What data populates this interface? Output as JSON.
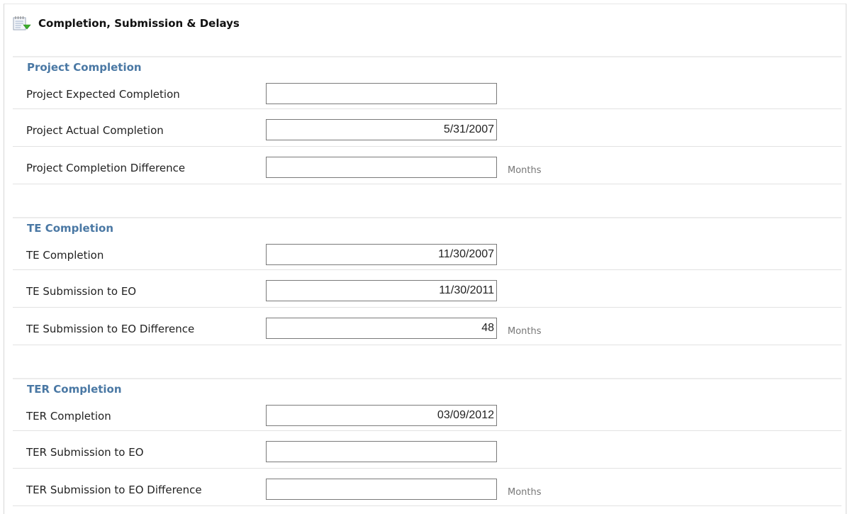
{
  "panel": {
    "title": "Completion, Submission & Delays",
    "icon": "notepad-checkmark-icon"
  },
  "colors": {
    "section_title": "#4a78a4",
    "row_divider": "#e2e2e2",
    "icon_accent": "#3cae2c"
  },
  "sections": [
    {
      "title": "Project Completion",
      "rows": [
        {
          "label": "Project Expected Completion",
          "value": "",
          "unit": ""
        },
        {
          "label": "Project Actual Completion",
          "value": "5/31/2007",
          "unit": ""
        },
        {
          "label": "Project Completion Difference",
          "value": "",
          "unit": "Months"
        }
      ]
    },
    {
      "title": "TE Completion",
      "rows": [
        {
          "label": "TE Completion",
          "value": "11/30/2007",
          "unit": ""
        },
        {
          "label": "TE Submission to EO",
          "value": "11/30/2011",
          "unit": ""
        },
        {
          "label": "TE Submission to EO Difference",
          "value": "48",
          "unit": "Months"
        }
      ]
    },
    {
      "title": "TER Completion",
      "rows": [
        {
          "label": "TER Completion",
          "value": "03/09/2012",
          "unit": ""
        },
        {
          "label": "TER Submission to EO",
          "value": "",
          "unit": ""
        },
        {
          "label": "TER Submission to EO Difference",
          "value": "",
          "unit": "Months"
        }
      ]
    }
  ]
}
